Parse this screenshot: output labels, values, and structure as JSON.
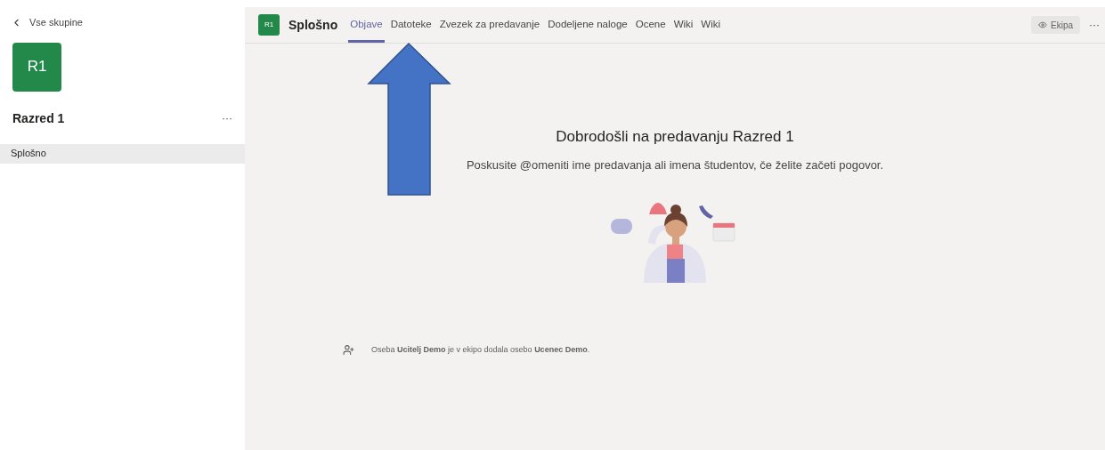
{
  "sidebar": {
    "back_link": "Vse skupine",
    "team_avatar": "R1",
    "team_name": "Razred 1",
    "more": "···",
    "channels": [
      {
        "label": "Splošno",
        "selected": true
      }
    ]
  },
  "header": {
    "channel_avatar": "R1",
    "channel_name": "Splošno",
    "tabs": [
      {
        "label": "Objave",
        "selected": true
      },
      {
        "label": "Datoteke",
        "selected": false
      },
      {
        "label": "Zvezek za predavanje",
        "selected": false
      },
      {
        "label": "Dodeljene naloge",
        "selected": false
      },
      {
        "label": "Ocene",
        "selected": false
      },
      {
        "label": "Wiki",
        "selected": false
      },
      {
        "label": "Wiki",
        "selected": false
      }
    ],
    "team_button": "Ekipa",
    "more": "···"
  },
  "welcome": {
    "title": "Dobrodošli na predavanju Razred 1",
    "subtitle": "Poskusite @omeniti ime predavanja ali imena študentov, če želite začeti pogovor."
  },
  "activity": {
    "text": "Oseba **Ucitelj Demo** je v ekipo dodala osebo **Ucenec Demo**."
  }
}
